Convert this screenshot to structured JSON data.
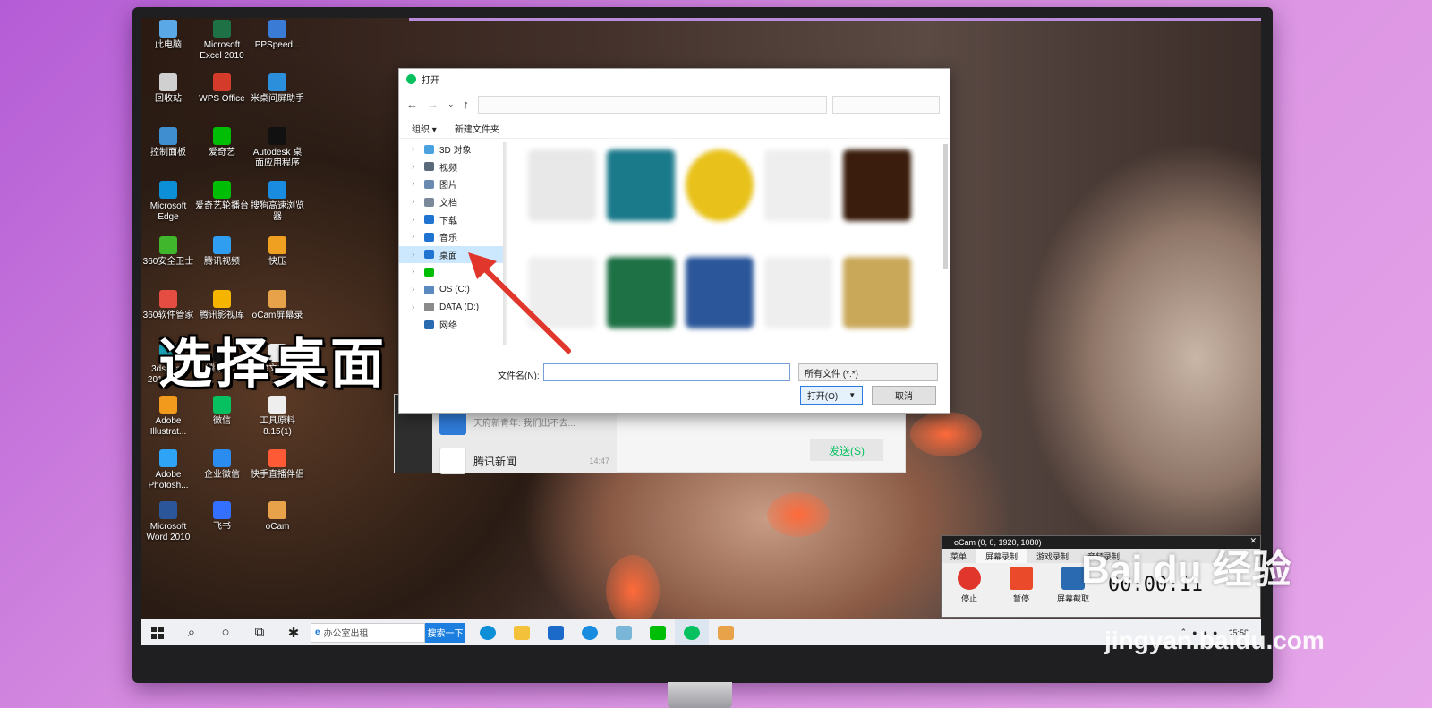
{
  "desktop": {
    "icons": [
      {
        "label": "此电脑",
        "color": "#5aa9e6"
      },
      {
        "label": "Microsoft Excel 2010",
        "color": "#1e7145"
      },
      {
        "label": "PPSpeed...",
        "color": "#3a7bd5"
      },
      {
        "label": "回收站",
        "color": "#d0d0d0"
      },
      {
        "label": "WPS Office",
        "color": "#d43b2a"
      },
      {
        "label": "米桌间屏助手",
        "color": "#2c8fdc"
      },
      {
        "label": "控制面板",
        "color": "#3e8ed0"
      },
      {
        "label": "爱奇艺",
        "color": "#00be06"
      },
      {
        "label": "Autodesk 桌面应用程序",
        "color": "#111111"
      },
      {
        "label": "Microsoft Edge",
        "color": "#0c8fd6"
      },
      {
        "label": "爱奇艺轮播台",
        "color": "#00be06"
      },
      {
        "label": "搜狗高速浏览器",
        "color": "#1a8ce0"
      },
      {
        "label": "360安全卫士",
        "color": "#3fb62c"
      },
      {
        "label": "腾讯视频",
        "color": "#2f9ef0"
      },
      {
        "label": "快压",
        "color": "#f0a020"
      },
      {
        "label": "360软件管家",
        "color": "#e54d42"
      },
      {
        "label": "腾讯影视库",
        "color": "#f4b400"
      },
      {
        "label": "oCam屏幕录",
        "color": "#e8a34a"
      },
      {
        "label": "3ds Max 2016 - S...",
        "color": "#1aa1b8"
      },
      {
        "label": "腾讯QQ",
        "color": "#111111"
      },
      {
        "label": "新建文本文档",
        "color": "#eeeeee"
      },
      {
        "label": "Adobe Illustrat...",
        "color": "#f29a1b"
      },
      {
        "label": "微信",
        "color": "#07c160"
      },
      {
        "label": "工具原料 8.15(1)",
        "color": "#eeeeee"
      },
      {
        "label": "Adobe Photosh...",
        "color": "#2fa3f5"
      },
      {
        "label": "企业微信",
        "color": "#2b8cf0"
      },
      {
        "label": "快手直播伴侣",
        "color": "#ff5a36"
      },
      {
        "label": "Microsoft Word 2010",
        "color": "#2b579a"
      },
      {
        "label": "飞书",
        "color": "#3370ff"
      },
      {
        "label": "oCam",
        "color": "#e8a34a"
      }
    ]
  },
  "caption": "选择桌面",
  "dialog": {
    "title": "打开",
    "toolbar": {
      "organize": "组织 ▾",
      "new_folder": "新建文件夹"
    },
    "tree": [
      {
        "label": "3D 对象",
        "color": "#4aa3df"
      },
      {
        "label": "视频",
        "color": "#5a6a7a"
      },
      {
        "label": "图片",
        "color": "#6a8ab0"
      },
      {
        "label": "文档",
        "color": "#7a8a9a"
      },
      {
        "label": "下载",
        "color": "#1e74d0"
      },
      {
        "label": "音乐",
        "color": "#1e74d0"
      },
      {
        "label": "桌面",
        "color": "#1e74d0"
      },
      {
        "label": "",
        "color": "#00be06"
      },
      {
        "label": "OS (C:)",
        "color": "#5a8ac0"
      },
      {
        "label": "DATA (D:)",
        "color": "#8a8a8a"
      },
      {
        "label": "网络",
        "color": "#2a6ab0"
      }
    ],
    "filename_label": "文件名(N):",
    "filename_value": "",
    "filetype": "所有文件 (*.*)",
    "open_label": "打开(O)",
    "cancel_label": "取消"
  },
  "chat": {
    "items": [
      {
        "title": "",
        "preview": "天府新青年: 我们出不去...",
        "time": ""
      },
      {
        "title": "腾讯新闻",
        "preview": "",
        "time": "14:47"
      }
    ],
    "send_label": "发送(S)"
  },
  "taskbar": {
    "search_placeholder": "办公室出租",
    "search_button": "搜索一下",
    "time": "15:58"
  },
  "ocam": {
    "title": "oCam (0, 0, 1920, 1080)",
    "tabs": [
      "菜单",
      "屏幕录制",
      "游戏录制",
      "音频录制"
    ],
    "active_tab": 1,
    "controls": [
      "停止",
      "暂停",
      "屏幕截取"
    ],
    "timer": "00:00:11"
  },
  "watermark": {
    "brand": "Bai du 经验",
    "url": "jingyan.baidu.com"
  }
}
